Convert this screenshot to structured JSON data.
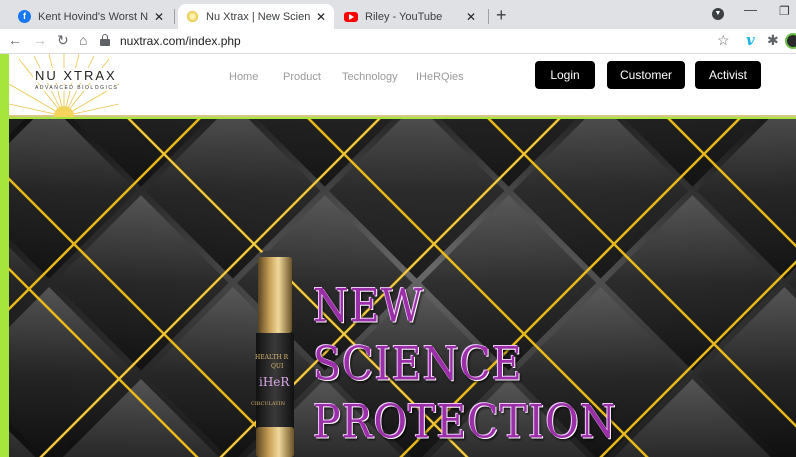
{
  "browser": {
    "tabs": [
      {
        "title": "Kent Hovind's Worst Nightmare (",
        "favicon": "facebook-favicon",
        "favicon_color": "#1877f2",
        "active": false
      },
      {
        "title": "Nu Xtrax | New Science Protectio",
        "favicon": "nuxtrax-favicon",
        "favicon_color": "#e8c547",
        "active": true
      },
      {
        "title": "Riley - YouTube",
        "favicon": "youtube-favicon",
        "favicon_color": "#ff0000",
        "active": false
      }
    ],
    "close_glyph": "✕",
    "new_tab_glyph": "+",
    "url": "nuxtrax.com/index.php"
  },
  "site": {
    "logo": {
      "name": "NU XTRAX",
      "tagline": "ADVANCED BIOLOGICS"
    },
    "nav": [
      "Home",
      "Product",
      "Technology",
      "IHeRQies"
    ],
    "buttons": {
      "login": "Login",
      "customer": "Customer",
      "activist": "Activist"
    }
  },
  "hero": {
    "headline": [
      "NEW",
      "SCIENCE",
      "PROTECTION"
    ],
    "bottle_label": {
      "line1": "HEALTH R",
      "line2": "QUI",
      "brand": "iHeR",
      "line3": "CIRCULATIN"
    }
  },
  "colors": {
    "page_border": "#a6e63c",
    "headline": "#9b2fa8",
    "gold": "#f2c21a",
    "button_bg": "#000000"
  }
}
